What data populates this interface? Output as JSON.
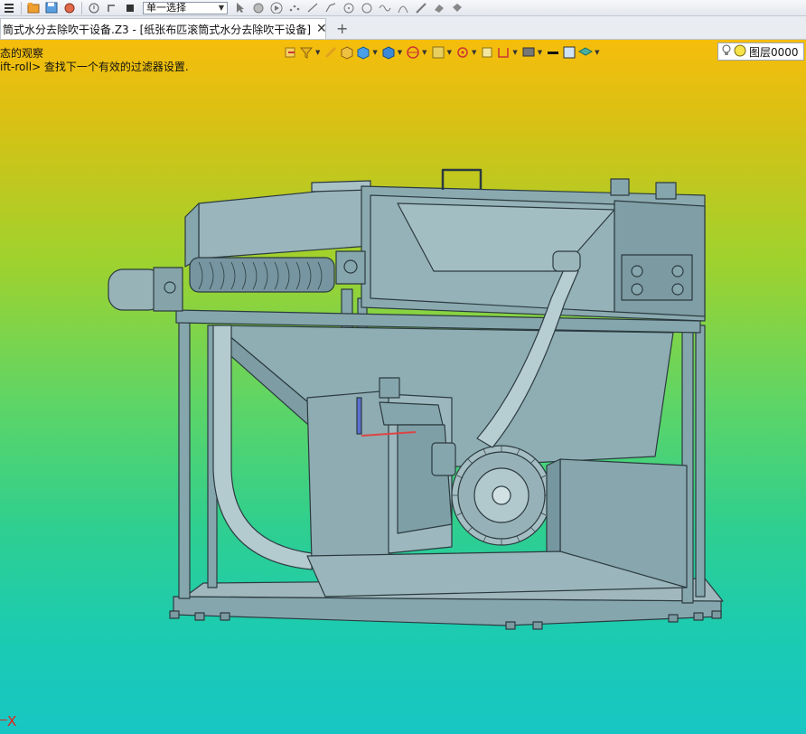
{
  "toolbar": {
    "selection_mode": "单一选择"
  },
  "tab": {
    "title": "筒式水分去除吹干设备.Z3 - [纸张布匹滚筒式水分去除吹干设备]",
    "close_symbol": "✕",
    "add_symbol": "+"
  },
  "hint": {
    "line1": "态的观察",
    "line2": "ift-roll> 查找下一个有效的过滤器设置."
  },
  "layer": {
    "name": "图层0000"
  },
  "axis": {
    "x_label": "X"
  },
  "colors": {
    "model_fill": "#86a6ad",
    "model_edge": "#2c3b40",
    "axis_x": "#e8201a",
    "bg_top": "#f6bd0c",
    "bg_bottom": "#17c6c4"
  }
}
